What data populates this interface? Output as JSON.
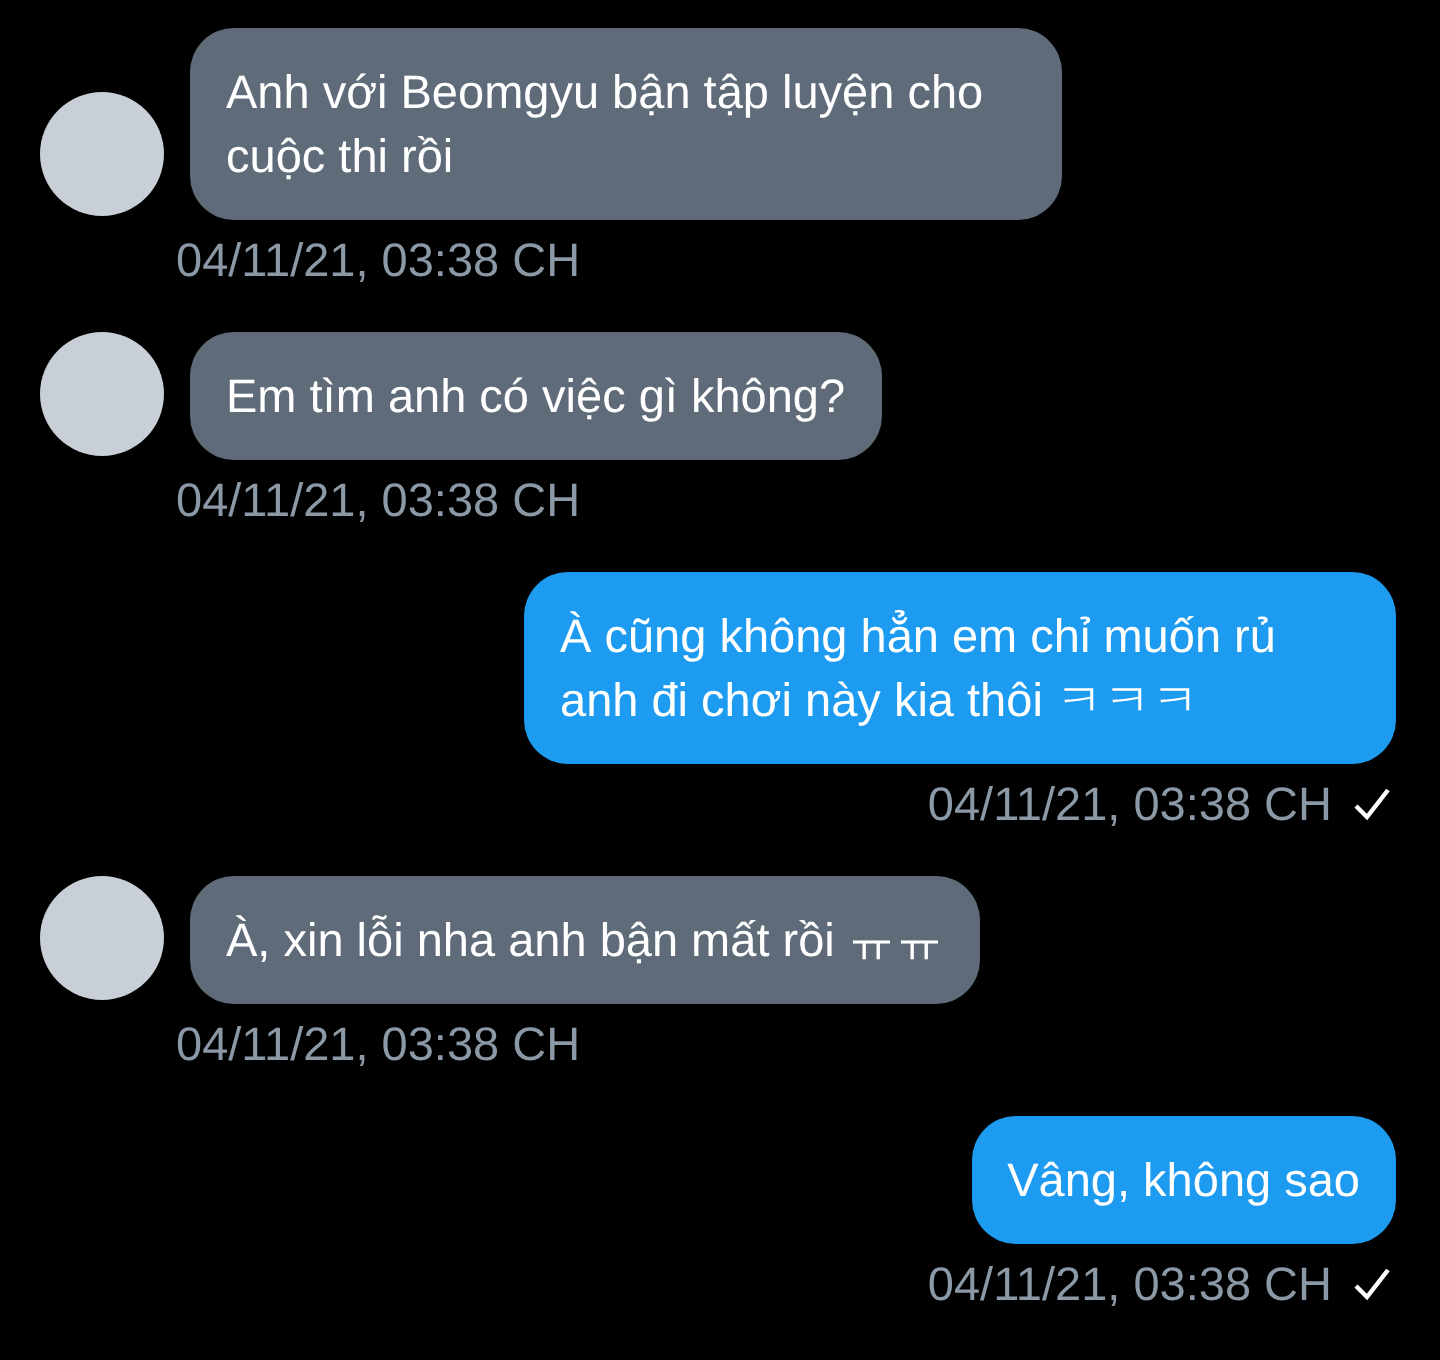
{
  "messages": [
    {
      "kind": "incoming",
      "text": "Anh với Beomgyu bận tập luyện cho cuộc thi rồi",
      "time": "04/11/21, 03:38 CH",
      "delivered": false
    },
    {
      "kind": "incoming",
      "text": "Em tìm anh có việc gì không?",
      "time": "04/11/21, 03:38 CH",
      "delivered": false
    },
    {
      "kind": "outgoing",
      "text": "À cũng không hẳn em chỉ muốn rủ anh đi chơi này kia thôi ㅋㅋㅋ",
      "time": "04/11/21, 03:38 CH",
      "delivered": true
    },
    {
      "kind": "incoming",
      "text": "À, xin lỗi nha anh bận mất rồi ㅠㅠ",
      "time": "04/11/21, 03:38 CH",
      "delivered": false
    },
    {
      "kind": "outgoing",
      "text": "Vâng, không sao",
      "time": "04/11/21, 03:38 CH",
      "delivered": true
    }
  ]
}
